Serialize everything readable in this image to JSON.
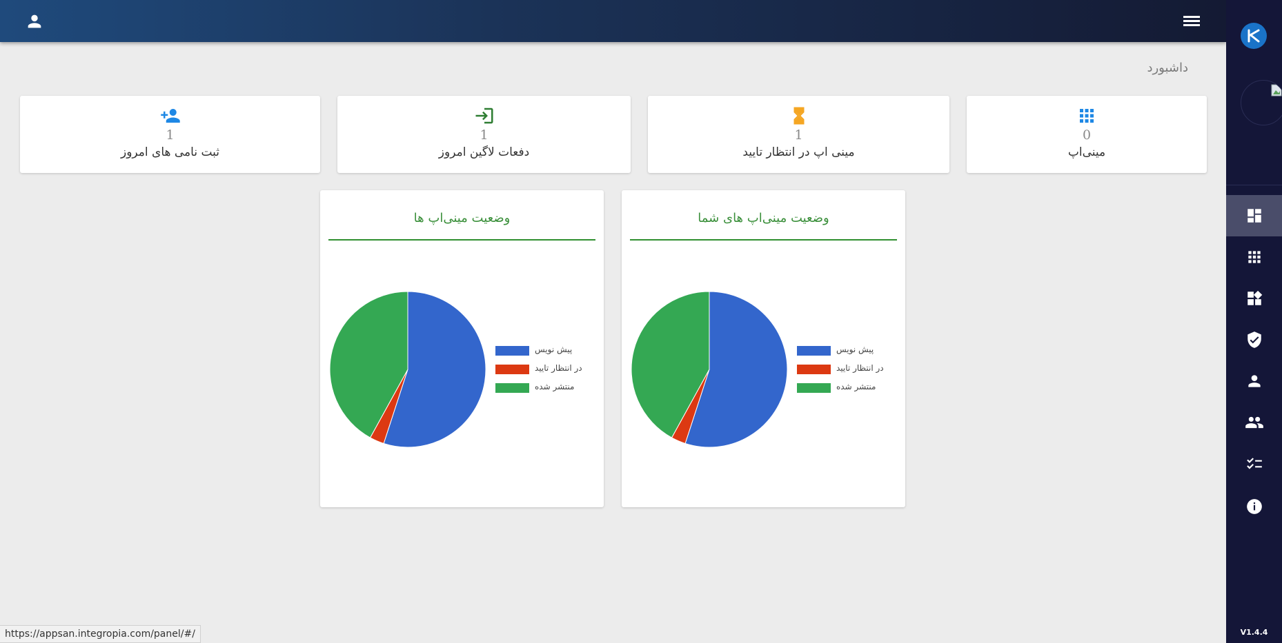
{
  "header": {
    "user_icon": "person-icon",
    "menu_icon": "hamburger-icon"
  },
  "sidebar": {
    "logo": "app-logo",
    "version": "V1.4.4",
    "items": [
      {
        "icon": "dashboard-icon",
        "active": true
      },
      {
        "icon": "apps-grid-icon",
        "active": false
      },
      {
        "icon": "widgets-icon",
        "active": false
      },
      {
        "icon": "shield-check-icon",
        "active": false
      },
      {
        "icon": "person-icon",
        "active": false
      },
      {
        "icon": "group-icon",
        "active": false
      },
      {
        "icon": "checklist-icon",
        "active": false
      },
      {
        "icon": "info-icon",
        "active": false
      }
    ]
  },
  "page": {
    "title": "داشبورد"
  },
  "stats": [
    {
      "value": "0",
      "label": "مینی‌اپ",
      "icon": "apps-grid-icon",
      "color": "#1e88e5"
    },
    {
      "value": "1",
      "label": "مینی اپ در انتظار تایید",
      "icon": "hourglass-icon",
      "color": "#f5a623"
    },
    {
      "value": "1",
      "label": "دفعات لاگین امروز",
      "icon": "login-icon",
      "color": "#2e7d32"
    },
    {
      "value": "1",
      "label": "ثبت نامی های امروز",
      "icon": "person-add-icon",
      "color": "#1e88e5"
    }
  ],
  "chart_data": [
    {
      "type": "pie",
      "title": "وضعیت مینی‌اپ های شما",
      "categories": [
        "پیش نویس",
        "در انتظار تایید",
        "منتشر شده"
      ],
      "values": [
        55,
        3,
        42
      ],
      "colors": [
        "#3366cc",
        "#dc3912",
        "#34a853"
      ],
      "legend": "right"
    },
    {
      "type": "pie",
      "title": "وضعیت مینی‌اپ ها",
      "categories": [
        "پیش نویس",
        "در انتظار تایید",
        "منتشر شده"
      ],
      "values": [
        55,
        3,
        42
      ],
      "colors": [
        "#3366cc",
        "#dc3912",
        "#34a853"
      ],
      "legend": "right"
    }
  ],
  "status_bar": {
    "url": "https://appsan.integropia.com/panel/#/"
  }
}
